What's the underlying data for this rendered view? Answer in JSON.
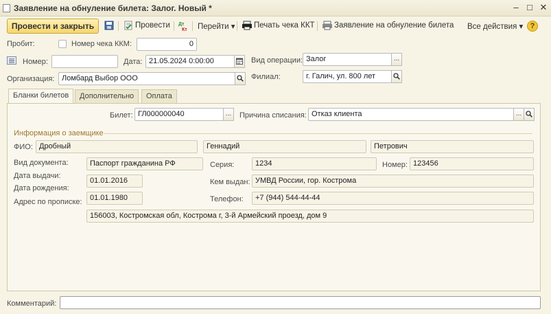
{
  "window": {
    "title": "Заявление на обнуление билета: Залог. Новый *",
    "controls": [
      "minimize",
      "maximize",
      "close"
    ]
  },
  "toolbar": {
    "post_close_label": "Провести и закрыть",
    "post_label": "Провести",
    "goto_label": "Перейти",
    "print_kkt_label": "Печать чека ККТ",
    "statement_label": "Заявление на обнуление билета",
    "all_actions_label": "Все действия",
    "help": "?"
  },
  "header": {
    "punched_label": "Пробит:",
    "kkm_check_label": "Номер чека ККМ:",
    "kkm_check_value": "0",
    "number_label": "Номер:",
    "number_value": "",
    "date_label": "Дата:",
    "date_value": "21.05.2024  0:00:00",
    "operation_label": "Вид операции:",
    "operation_value": "Залог",
    "organization_label": "Организация:",
    "organization_value": "Ломбард Выбор ООО",
    "branch_label": "Филиал:",
    "branch_value": "г. Галич, ул. 800 лет"
  },
  "tabs": [
    {
      "label": "Бланки билетов",
      "active": true
    },
    {
      "label": "Дополнительно",
      "active": false
    },
    {
      "label": "Оплата",
      "active": false
    }
  ],
  "ticket": {
    "ticket_label": "Билет:",
    "ticket_value": "ГЛ000000040",
    "reason_label": "Причина списания:",
    "reason_value": "Отказ клиента"
  },
  "borrower": {
    "section_title": "Информация о заемщике",
    "fio_label": "ФИО:",
    "last_name": "Дробный",
    "first_name": "Геннадий",
    "middle_name": "Петрович",
    "doc_type_label": "Вид документа:",
    "doc_type_value": "Паспорт гражданина РФ",
    "series_label": "Серия:",
    "series_value": "1234",
    "number_label": "Номер:",
    "number_value": "123456",
    "issue_date_label": "Дата выдачи:",
    "issue_date_value": "01.01.2016",
    "issued_by_label": "Кем выдан:",
    "issued_by_value": "УМВД России, гор. Кострома",
    "birth_date_label": "Дата рождения:",
    "birth_date_value": "01.01.1980",
    "phone_label": "Телефон:",
    "phone_value": "+7 (944) 544-44-44",
    "address_label": "Адрес по прописке:",
    "address_value": "156003, Костромская обл, Кострома г, 3-й Армейский проезд, дом 9"
  },
  "footer": {
    "comment_label": "Комментарий:",
    "comment_value": ""
  }
}
